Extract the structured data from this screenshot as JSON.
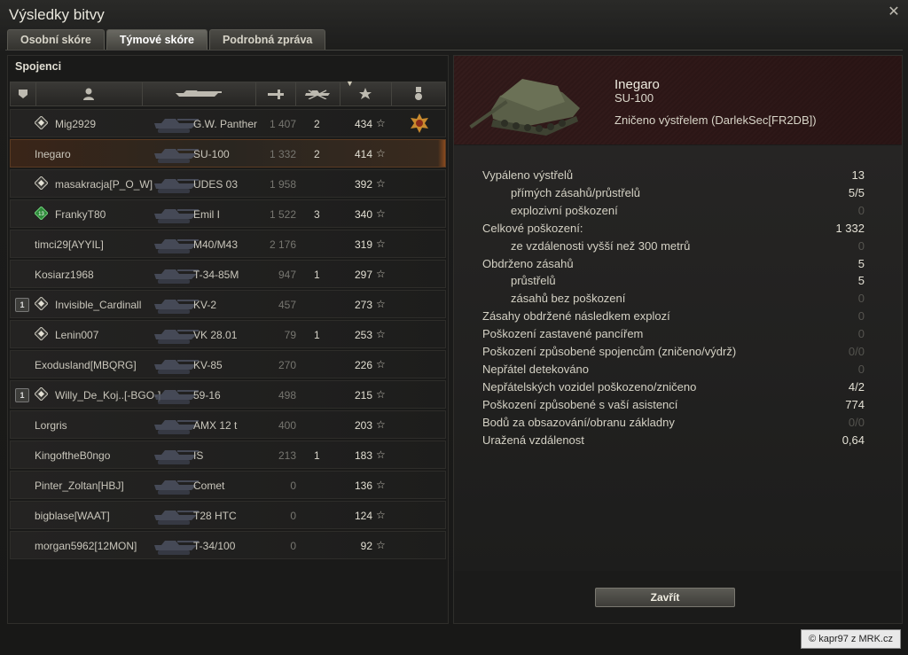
{
  "window": {
    "title": "Výsledky bitvy"
  },
  "tabs": [
    {
      "label": "Osobní skóre"
    },
    {
      "label": "Týmové skóre"
    },
    {
      "label": "Podrobná zpráva"
    }
  ],
  "team": {
    "title": "Spojenci",
    "columns": [
      "squad-icon",
      "player-icon",
      "tank-icon",
      "damage-icon",
      "kills-icon",
      "xp-star-icon",
      "medal-icon"
    ],
    "rows": [
      {
        "name": "Mig2929",
        "tank": "G.W. Panther",
        "damage": "1 407",
        "kills": "2",
        "xp": "434",
        "rank": "diamond",
        "squad": "",
        "medal": true
      },
      {
        "name": "Inegaro",
        "tank": "SU-100",
        "damage": "1 332",
        "kills": "2",
        "xp": "414",
        "rank": "",
        "squad": "",
        "selected": true
      },
      {
        "name": "masakracja[P_O_W]",
        "tank": "UDES 03",
        "damage": "1 958",
        "kills": "",
        "xp": "392",
        "rank": "diamond",
        "squad": ""
      },
      {
        "name": "FrankyT80",
        "tank": "Emil I",
        "damage": "1 522",
        "kills": "3",
        "xp": "340",
        "rank": "green",
        "squad": ""
      },
      {
        "name": "timci29[AYYIL]",
        "tank": "M40/M43",
        "damage": "2 176",
        "kills": "",
        "xp": "319",
        "rank": "",
        "squad": ""
      },
      {
        "name": "Kosiarz1968",
        "tank": "T-34-85M",
        "damage": "947",
        "kills": "1",
        "xp": "297",
        "rank": "",
        "squad": ""
      },
      {
        "name": "Invisible_Cardinall",
        "tank": "KV-2",
        "damage": "457",
        "kills": "",
        "xp": "273",
        "rank": "diamond",
        "squad": "1"
      },
      {
        "name": "Lenin007",
        "tank": "VK 28.01",
        "damage": "79",
        "kills": "1",
        "xp": "253",
        "rank": "diamond",
        "squad": ""
      },
      {
        "name": "Exodusland[MBQRG]",
        "tank": "KV-85",
        "damage": "270",
        "kills": "",
        "xp": "226",
        "rank": "",
        "squad": ""
      },
      {
        "name": "Willy_De_Koj..[-BGO-]",
        "tank": "59-16",
        "damage": "498",
        "kills": "",
        "xp": "215",
        "rank": "diamond",
        "squad": "1"
      },
      {
        "name": "Lorgris",
        "tank": "AMX 12 t",
        "damage": "400",
        "kills": "",
        "xp": "203",
        "rank": "",
        "squad": ""
      },
      {
        "name": "KingoftheB0ngo",
        "tank": "IS",
        "damage": "213",
        "kills": "1",
        "xp": "183",
        "rank": "",
        "squad": ""
      },
      {
        "name": "Pinter_Zoltan[HBJ]",
        "tank": "Comet",
        "damage": "0",
        "kills": "",
        "xp": "136",
        "rank": "",
        "squad": ""
      },
      {
        "name": "bigblase[WAAT]",
        "tank": "T28 HTC",
        "damage": "0",
        "kills": "",
        "xp": "124",
        "rank": "",
        "squad": ""
      },
      {
        "name": "morgan5962[12MON]",
        "tank": "T-34/100",
        "damage": "0",
        "kills": "",
        "xp": "92",
        "rank": "",
        "squad": ""
      }
    ]
  },
  "detail": {
    "player": "Inegaro",
    "tank": "SU-100",
    "death": "Zničeno výstřelem (DarlekSec[FR2DB])",
    "stats": [
      {
        "label": "Vypáleno výstřelů",
        "value": "13",
        "sub": false,
        "dim": false
      },
      {
        "label": "přímých zásahů/průstřelů",
        "value": "5/5",
        "sub": true,
        "dim": false
      },
      {
        "label": "explozivní poškození",
        "value": "0",
        "sub": true,
        "dim": true
      },
      {
        "label": "Celkové poškození:",
        "value": "1 332",
        "sub": false,
        "dim": false
      },
      {
        "label": "ze vzdálenosti vyšší než 300 metrů",
        "value": "0",
        "sub": true,
        "dim": true
      },
      {
        "label": "Obdrženo zásahů",
        "value": "5",
        "sub": false,
        "dim": false
      },
      {
        "label": "průstřelů",
        "value": "5",
        "sub": true,
        "dim": false
      },
      {
        "label": "zásahů bez poškození",
        "value": "0",
        "sub": true,
        "dim": true
      },
      {
        "label": "Zásahy obdržené následkem explozí",
        "value": "0",
        "sub": false,
        "dim": true
      },
      {
        "label": "Poškození zastavené pancířem",
        "value": "0",
        "sub": false,
        "dim": true
      },
      {
        "label": "Poškození způsobené spojencům (zničeno/výdrž)",
        "value": "0/0",
        "sub": false,
        "dim": true
      },
      {
        "label": "Nepřátel detekováno",
        "value": "0",
        "sub": false,
        "dim": true
      },
      {
        "label": "Nepřátelských vozidel poškozeno/zničeno",
        "value": "4/2",
        "sub": false,
        "dim": false
      },
      {
        "label": "Poškození způsobené s vaší asistencí",
        "value": "774",
        "sub": false,
        "dim": false
      },
      {
        "label": "Bodů za obsazování/obranu základny",
        "value": "0/0",
        "sub": false,
        "dim": true
      },
      {
        "label": "Uražená vzdálenost",
        "value": "0,64",
        "sub": false,
        "dim": false
      }
    ],
    "close_label": "Zavřít"
  },
  "watermark": "© kapr97 z MRK.cz"
}
